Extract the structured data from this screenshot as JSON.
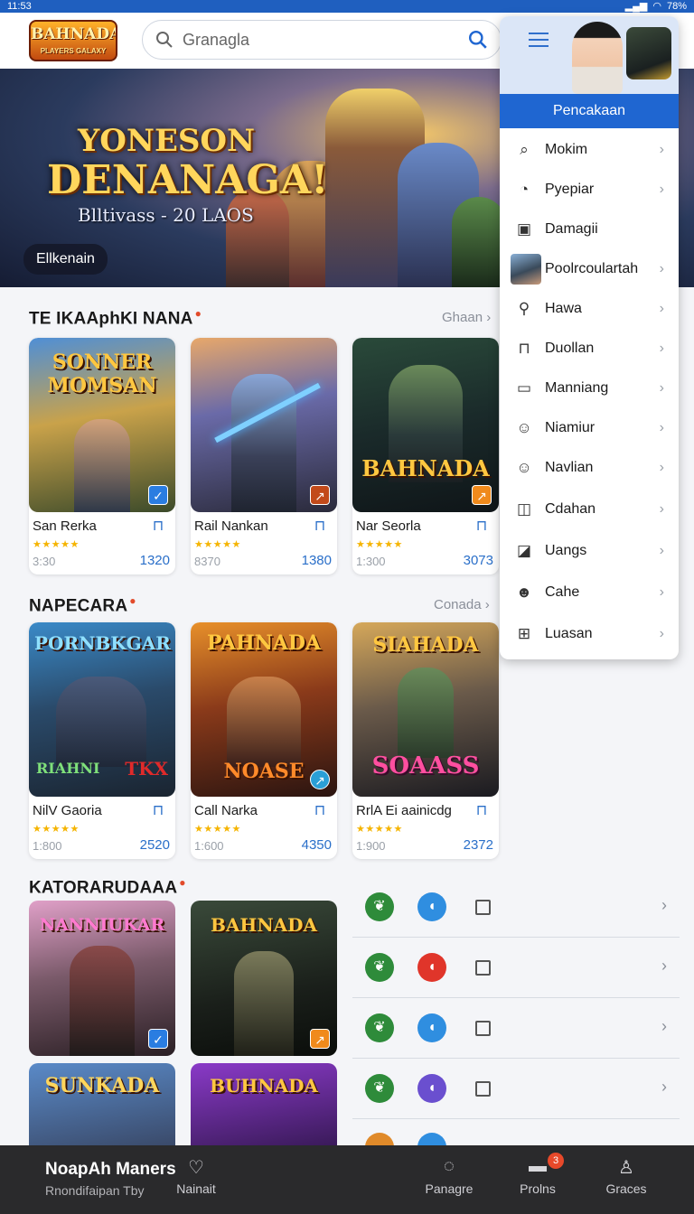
{
  "status_bar": {
    "time": "11:53",
    "battery": "78%"
  },
  "header": {
    "logo_text": "BAHNADA",
    "logo_sub": "PLAYERS GALAXY",
    "search_placeholder": "Granagla"
  },
  "hero": {
    "title_line1": "YONESON",
    "title_line2": "DENANAGA!",
    "subtitle": "Blltivass - 20 LAOS",
    "button": "Ellkenain"
  },
  "section1": {
    "title": "TE IKAAphKI NANA",
    "more": "Ghaan",
    "cards": [
      {
        "art_title": "SONNER MOMSAN",
        "name": "San Rerka",
        "stars": "★★★★★",
        "left": "3:30",
        "right": "1320",
        "accent": "#2a7de1"
      },
      {
        "art_title": "",
        "name": "Rail Nankan",
        "stars": "★★★★★",
        "left": "8370",
        "right": "1380",
        "accent": "#c24a1a"
      },
      {
        "art_title": "BAHNADA",
        "name": "Nar Seorla",
        "stars": "★★★★★",
        "left": "1:300",
        "right": "3073",
        "accent": "#f08a1c"
      }
    ]
  },
  "section2": {
    "title": "NAPECARA",
    "more": "Conada",
    "cards": [
      {
        "art_title": "PORNBKGAR",
        "art_sub": "RIAHNI",
        "name": "NilV Gaoria",
        "stars": "★★★★★",
        "left": "1:800",
        "right": "2520",
        "accent": "#e02a2a"
      },
      {
        "art_title": "PAHNADA",
        "art_sub": "NOASE",
        "name": "Call Narka",
        "stars": "★★★★★",
        "left": "1:600",
        "right": "4350",
        "accent": "#2a9fd6"
      },
      {
        "art_title": "SIAHADA",
        "art_sub": "SOAASS",
        "name": "RrlA Ei aainicdg",
        "stars": "★★★★★",
        "left": "1:900",
        "right": "2372",
        "accent": "#e0307a"
      }
    ]
  },
  "section3": {
    "title": "KATORARUDAAA",
    "arts": [
      {
        "art_title": "NANNIUKAR"
      },
      {
        "art_title": "BAHNADA"
      },
      {
        "art_title": "SUNKADA"
      },
      {
        "art_title": "BUHNADA"
      }
    ],
    "rows": [
      {
        "c1": "#2e8b3a",
        "c2": "#2f8ee0"
      },
      {
        "c1": "#2e8b3a",
        "c2": "#e0352a"
      },
      {
        "c1": "#2e8b3a",
        "c2": "#2f8ee0"
      },
      {
        "c1": "#2e8b3a",
        "c2": "#6a4fcf"
      }
    ]
  },
  "menu": {
    "header": "Pencakaan",
    "items": [
      {
        "label": "Mokim",
        "icon": "search-icon",
        "glyph": "⌕"
      },
      {
        "label": "Pyepiar",
        "icon": "palette-icon",
        "glyph": "◔"
      },
      {
        "label": "Damagii",
        "icon": "image-icon",
        "glyph": "▣"
      },
      {
        "label": "Poolrcoulartah",
        "icon": "avatar-icon",
        "glyph": ""
      },
      {
        "label": "Hawa",
        "icon": "key-icon",
        "glyph": "⚲"
      },
      {
        "label": "Duollan",
        "icon": "bag-icon",
        "glyph": "⊓"
      },
      {
        "label": "Manniang",
        "icon": "wallet-icon",
        "glyph": "▭"
      },
      {
        "label": "Niamiur",
        "icon": "user-icon",
        "glyph": "☺"
      },
      {
        "label": "Navlian",
        "icon": "smiley-icon",
        "glyph": "☺"
      },
      {
        "label": "Cdahan",
        "icon": "window-icon",
        "glyph": "◫"
      },
      {
        "label": "Uangs",
        "icon": "photo-icon",
        "glyph": "◪"
      },
      {
        "label": "Cahe",
        "icon": "face-icon",
        "glyph": "☻"
      },
      {
        "label": "Luasan",
        "icon": "grid-icon",
        "glyph": "⊞"
      }
    ]
  },
  "bottom_bar": {
    "title": "NoapAh Maners",
    "subtitle": "Rnondifaipan Tby",
    "items": [
      {
        "label": "Nainait",
        "icon": "heart-icon",
        "glyph": "♡"
      },
      {
        "label": "Panagre",
        "icon": "chat-icon",
        "glyph": "◌"
      },
      {
        "label": "Prolns",
        "icon": "inbox-icon",
        "glyph": "▬"
      },
      {
        "label": "Graces",
        "icon": "profile-icon",
        "glyph": "♙"
      }
    ],
    "badge": "3"
  }
}
